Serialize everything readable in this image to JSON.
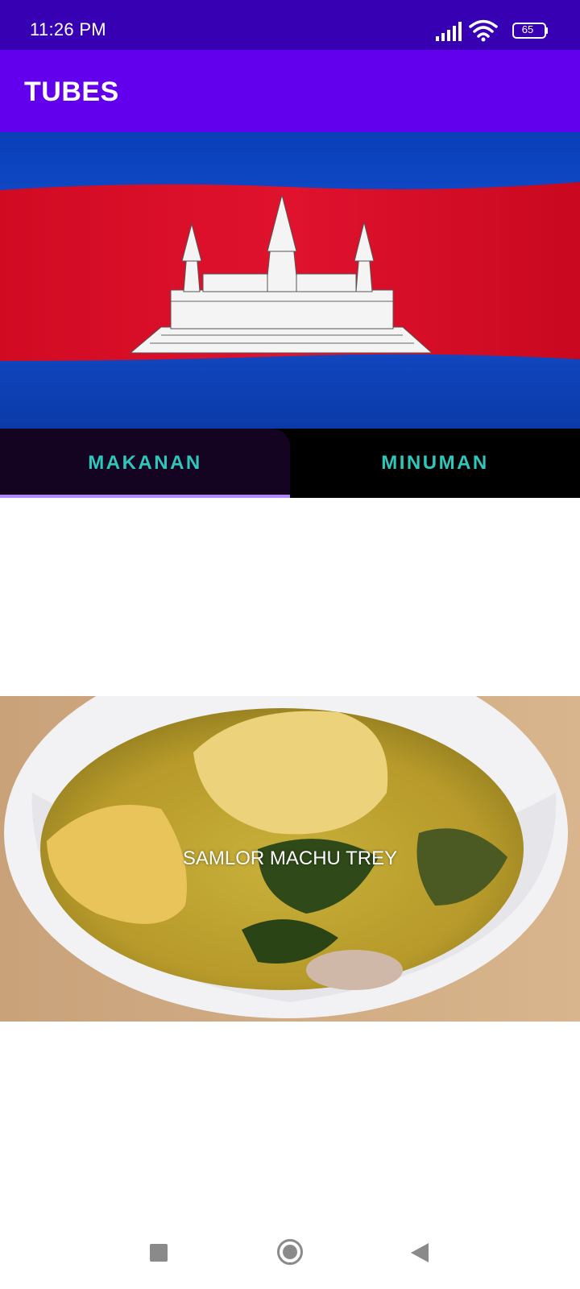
{
  "status_bar": {
    "time": "11:26 PM",
    "battery_level": "65",
    "icons": [
      "signal-icon",
      "wifi-icon",
      "battery-icon"
    ]
  },
  "app_bar": {
    "title": "TUBES"
  },
  "banner": {
    "image": "cambodia-flag-image"
  },
  "tabs": [
    {
      "label": "MAKANAN",
      "selected": true
    },
    {
      "label": "MINUMAN",
      "selected": false
    }
  ],
  "food_item": {
    "name": "SAMLOR MACHU TREY",
    "image": "fish-soup-image"
  },
  "nav_bar": {
    "icons": [
      "recent-apps-icon",
      "home-icon",
      "back-icon"
    ]
  },
  "colors": {
    "status_bar": "#3700b3",
    "app_bar": "#6200ee",
    "tab_text": "#2ec8bb",
    "tab_indicator": "#b388ff"
  }
}
